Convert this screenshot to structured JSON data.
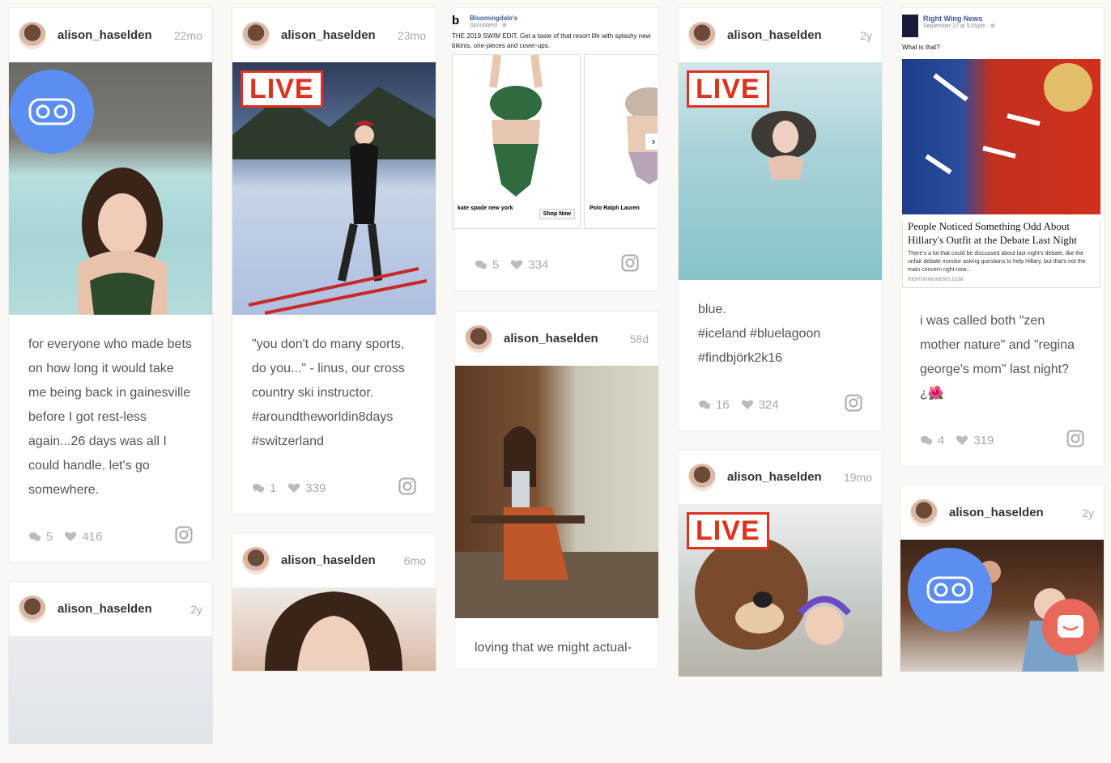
{
  "username": "alison_haselden",
  "live_label": "LIVE",
  "cards": {
    "c1": {
      "time": "22mo",
      "caption": "for everyone who made bets on how long it would take me being back in gainesville before I got rest-less again...26 days was all I could handle. let's go somewhere.",
      "comments": "5",
      "likes": "416"
    },
    "c2": {
      "time": "2y"
    },
    "c3": {
      "time": "23mo",
      "caption": "\"you don't do many sports, do you...\" - linus, our cross country ski instructor. #aroundtheworldin8days #switzerland",
      "comments": "1",
      "likes": "339"
    },
    "c4": {
      "time": "6mo"
    },
    "c5": {
      "comments": "5",
      "likes": "334"
    },
    "c6": {
      "time": "58d",
      "caption": "loving that we might actual-"
    },
    "c7": {
      "time": "2y",
      "caption_lines": [
        "blue.",
        "#iceland #bluelagoon",
        "#findbjörk2k16"
      ],
      "comments": "16",
      "likes": "324"
    },
    "c8": {
      "time": "19mo"
    },
    "c9": {
      "caption": "i was called both \"zen mother nature\" and \"regina george's mom\" last night? ¿🌺",
      "comments": "4",
      "likes": "319"
    },
    "c10": {
      "time": "2y"
    }
  },
  "ad": {
    "brand": "Bloomingdale's",
    "sponsored": "Sponsored · ⊕",
    "text": "THE 2019 SWIM EDIT. Get a taste of that resort life with splashy new bikinis, one-pieces and cover-ups.",
    "products": [
      {
        "label": "kate spade new york",
        "button": "Shop Now"
      },
      {
        "label": "Polo Ralph Lauren"
      }
    ]
  },
  "news": {
    "source": "Right Wing News",
    "date": "September 27 at 5:05pm · ⊕",
    "prompt": "What is that?",
    "headline": "People Noticed Something Odd About Hillary's Outfit at the Debate Last Night",
    "desc": "There's a lot that could be discussed about last night's debate, like the unfair debate monitor asking questions to help Hillary, but that's not the main concern right now...",
    "url": "RIGHTWINGNEWS.COM"
  },
  "colors": {
    "live": "#e0311f",
    "vr": "#5b8ef0",
    "chat": "#e8685a"
  }
}
